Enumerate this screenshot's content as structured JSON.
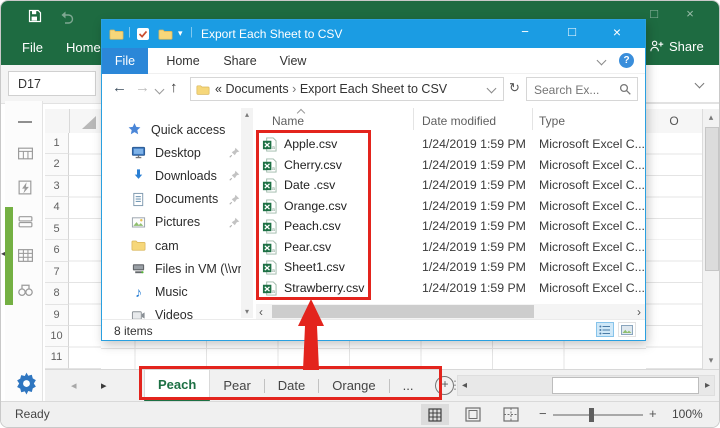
{
  "colors": {
    "excel_green": "#1e6b41",
    "explorer_blue": "#1b9ce3",
    "menu_file_blue": "#2b87d8",
    "annotation_red": "#e3241d",
    "active_sheet_green": "#1d7044"
  },
  "icons": {
    "minimize": "−",
    "maximize": "□",
    "close": "×",
    "back": "←",
    "forward": "→",
    "up": "↑",
    "refresh": "↻",
    "dropdown": "▾",
    "overflow": "⋮",
    "scroll_left": "◂",
    "scroll_right": "▸",
    "scroll_up": "▴",
    "scroll_down": "▾",
    "chevron_left": "‹",
    "chevron_right": "›",
    "guillemet": "«",
    "crumb_separator": "›",
    "music_note": "♪",
    "help": "?",
    "plus": "+",
    "minus": "−",
    "pipe": "|"
  },
  "excel": {
    "ribbon": {
      "file_tab": "File",
      "home_tab": "Home",
      "share_label": "Share"
    },
    "name_box": "D17",
    "visible_column_header": "O",
    "row_numbers": [
      "1",
      "2",
      "3",
      "4",
      "5",
      "6",
      "7",
      "8",
      "9",
      "10",
      "11"
    ],
    "sheet_tabs": {
      "active": "Peach",
      "tabs": [
        "Peach",
        "Pear",
        "Date",
        "Orange",
        "..."
      ]
    },
    "status_bar": {
      "mode": "Ready",
      "zoom_percent": "100%"
    }
  },
  "explorer": {
    "title": "Export Each Sheet to CSV",
    "menu_tabs": [
      "File",
      "Home",
      "Share",
      "View"
    ],
    "address": {
      "prefix": "«",
      "crumbs": [
        "Documents",
        "Export Each Sheet to CSV"
      ],
      "separator": "›"
    },
    "search_placeholder": "Search Ex...",
    "sidebar_items": [
      {
        "label": "Quick access",
        "pinned": false
      },
      {
        "label": "Desktop",
        "pinned": true
      },
      {
        "label": "Downloads",
        "pinned": true
      },
      {
        "label": "Documents",
        "pinned": true
      },
      {
        "label": "Pictures",
        "pinned": true
      },
      {
        "label": "cam",
        "pinned": false
      },
      {
        "label": "Files in VM (\\\\vn",
        "pinned": false
      },
      {
        "label": "Music",
        "pinned": false
      },
      {
        "label": "Videos",
        "pinned": false
      }
    ],
    "list": {
      "columns": [
        "Name",
        "Date modified",
        "Type"
      ],
      "files": [
        {
          "name": "Apple.csv",
          "modified": "1/24/2019 1:59 PM",
          "type": "Microsoft Excel C..."
        },
        {
          "name": "Cherry.csv",
          "modified": "1/24/2019 1:59 PM",
          "type": "Microsoft Excel C..."
        },
        {
          "name": "Date .csv",
          "modified": "1/24/2019 1:59 PM",
          "type": "Microsoft Excel C..."
        },
        {
          "name": "Orange.csv",
          "modified": "1/24/2019 1:59 PM",
          "type": "Microsoft Excel C..."
        },
        {
          "name": "Peach.csv",
          "modified": "1/24/2019 1:59 PM",
          "type": "Microsoft Excel C..."
        },
        {
          "name": "Pear.csv",
          "modified": "1/24/2019 1:59 PM",
          "type": "Microsoft Excel C..."
        },
        {
          "name": "Sheet1.csv",
          "modified": "1/24/2019 1:59 PM",
          "type": "Microsoft Excel C..."
        },
        {
          "name": "Strawberry.csv",
          "modified": "1/24/2019 1:59 PM",
          "type": "Microsoft Excel C..."
        }
      ]
    },
    "status_bar": {
      "item_count": "8 items"
    }
  }
}
